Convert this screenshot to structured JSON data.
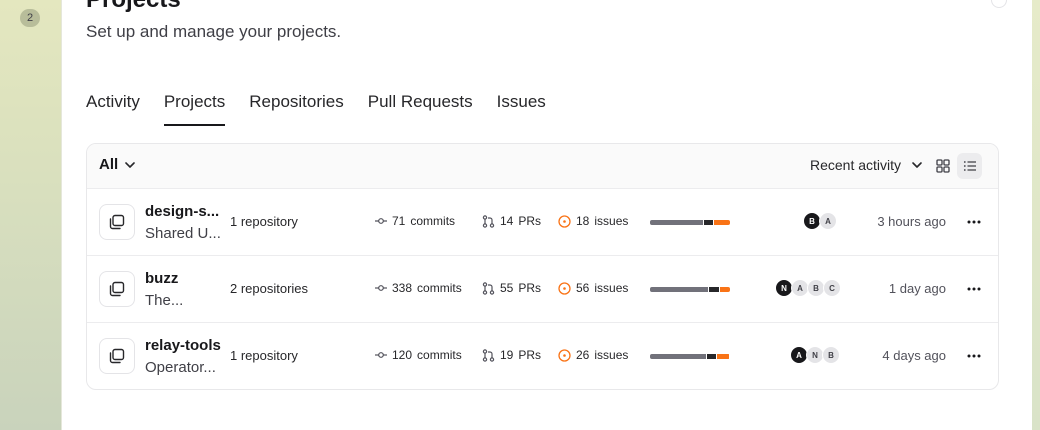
{
  "step_badge": "2",
  "page": {
    "title": "Projects",
    "subtitle": "Set up and manage your projects."
  },
  "tabs": [
    {
      "label": "Activity",
      "active": false
    },
    {
      "label": "Projects",
      "active": true
    },
    {
      "label": "Repositories",
      "active": false
    },
    {
      "label": "Pull Requests",
      "active": false
    },
    {
      "label": "Issues",
      "active": false
    }
  ],
  "toolbar": {
    "filter_label": "All",
    "sort_label": "Recent activity",
    "view_modes": [
      "grid-icon",
      "list-icon"
    ],
    "active_view": "list"
  },
  "colors": {
    "accent_orange": "#f97316",
    "bar_gray": "#71717a",
    "bar_dark": "#27272a"
  },
  "projects": [
    {
      "name": "design-s...",
      "description": "Shared U...",
      "repositories": "1 repository",
      "commits_num": "71",
      "commits_label": "commits",
      "prs_num": "14",
      "prs_label": "PRs",
      "issues_num": "18",
      "issues_label": "issues",
      "bar": [
        0.68,
        0.12,
        0.2
      ],
      "avatars": [
        "B",
        "A"
      ],
      "time": "3 hours ago"
    },
    {
      "name": "buzz",
      "description": "The...",
      "repositories": "2 repositories",
      "commits_num": "338",
      "commits_label": "commits",
      "prs_num": "55",
      "prs_label": "PRs",
      "issues_num": "56",
      "issues_label": "issues",
      "bar": [
        0.74,
        0.13,
        0.13
      ],
      "avatars": [
        "N",
        "A",
        "B",
        "C"
      ],
      "time": "1 day ago"
    },
    {
      "name": "relay-tools",
      "description": "Operator...",
      "repositories": "1 repository",
      "commits_num": "120",
      "commits_label": "commits",
      "prs_num": "19",
      "prs_label": "PRs",
      "issues_num": "26",
      "issues_label": "issues",
      "bar": [
        0.72,
        0.12,
        0.16
      ],
      "avatars": [
        "A",
        "N",
        "B"
      ],
      "time": "4 days ago"
    }
  ]
}
